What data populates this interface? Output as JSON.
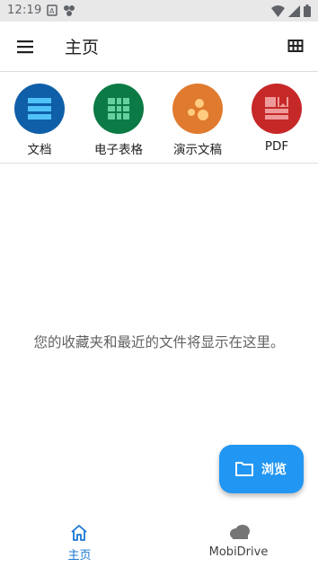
{
  "status_bar": {
    "time": "12:19",
    "left_icons": [
      "a-box-icon",
      "share-nodes-icon"
    ],
    "right_icons": [
      "wifi-icon",
      "signal-icon",
      "battery-icon"
    ]
  },
  "app_bar": {
    "title": "主页",
    "menu_icon": "hamburger-menu-icon",
    "view_icon": "grid-view-icon"
  },
  "create_items": [
    {
      "label": "文档",
      "icon": "document-icon",
      "color": "#0f5fa8"
    },
    {
      "label": "电子表格",
      "icon": "spreadsheet-icon",
      "color": "#0c7a45"
    },
    {
      "label": "演示文稿",
      "icon": "presentation-icon",
      "color": "#e07a2e"
    },
    {
      "label": "PDF",
      "icon": "pdf-icon",
      "color": "#c62828"
    }
  ],
  "empty_state": {
    "message": "您的收藏夹和最近的文件将显示在这里。"
  },
  "fab": {
    "label": "浏览",
    "icon": "folder-icon",
    "color": "#2196f3"
  },
  "bottom_nav": {
    "items": [
      {
        "label": "主页",
        "icon": "home-icon",
        "active": true,
        "color": "#1976d2"
      },
      {
        "label": "MobiDrive",
        "icon": "cloud-icon",
        "active": false,
        "color": "#757575"
      }
    ]
  }
}
